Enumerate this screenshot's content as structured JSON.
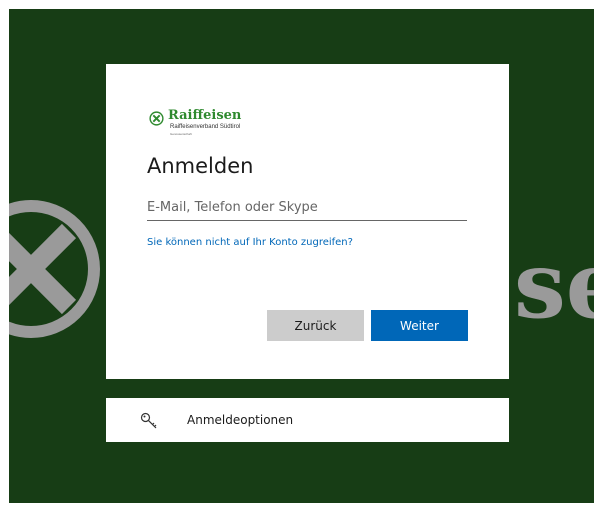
{
  "background": {
    "color": "#173d15",
    "brand_fragment": "se",
    "emblem_icon": "raiffeisen-emblem-icon"
  },
  "logo": {
    "icon": "raiffeisen-cross-icon",
    "name": "Raiffeisen",
    "subtitle": "Raiffeisenverband Südtirol",
    "tagline": "Genossenschaft"
  },
  "signin": {
    "title": "Anmelden",
    "input_placeholder": "E-Mail, Telefon oder Skype",
    "input_value": "",
    "help_link": "Sie können nicht auf Ihr Konto zugreifen?",
    "back_label": "Zurück",
    "next_label": "Weiter"
  },
  "signin_options": {
    "icon": "key-icon",
    "label": "Anmeldeoptionen"
  },
  "colors": {
    "primary_button": "#0067b8",
    "secondary_button": "#cccccc",
    "link": "#0067b8",
    "brand_green": "#2f8a2f"
  }
}
